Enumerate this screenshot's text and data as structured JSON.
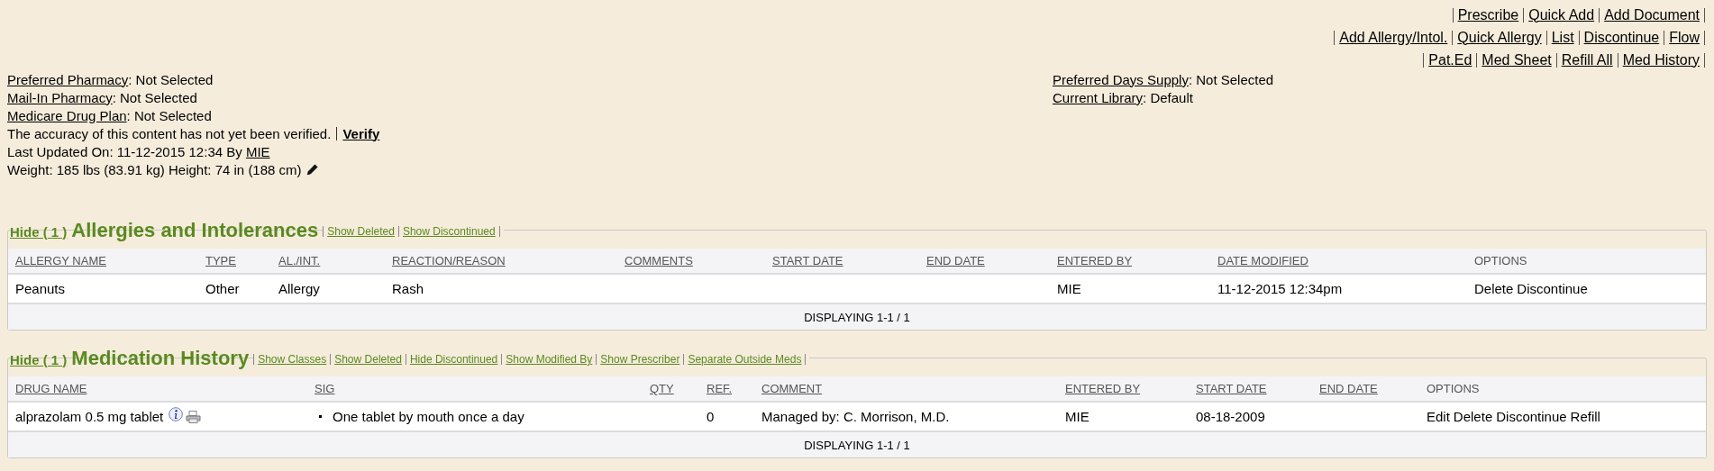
{
  "toolbar": {
    "rows": [
      [
        "Prescribe",
        "Quick Add",
        "Add Document"
      ],
      [
        "Add Allergy/Intol.",
        "Quick Allergy",
        "List",
        "Discontinue",
        "Flow"
      ],
      [
        "Pat.Ed",
        "Med Sheet",
        "Refill All",
        "Med History"
      ]
    ]
  },
  "info": {
    "left": [
      {
        "kind": "field",
        "label": "Preferred Pharmacy",
        "value": ": Not Selected"
      },
      {
        "kind": "field",
        "label": "Mail-In Pharmacy",
        "value": ": Not Selected"
      },
      {
        "kind": "field",
        "label": "Medicare Drug Plan",
        "value": ": Not Selected"
      },
      {
        "kind": "verify",
        "text": "The accuracy of this content has not yet been verified.",
        "link": "Verify"
      },
      {
        "kind": "updated",
        "text": "Last Updated On: 11-12-2015 12:34 By",
        "link": "MIE"
      },
      {
        "kind": "vitals",
        "text": "Weight: 185 lbs (83.91 kg) Height: 74 in (188 cm)"
      }
    ],
    "right": [
      {
        "kind": "field",
        "label": "Preferred Days Supply",
        "value": ": Not Selected"
      },
      {
        "kind": "field",
        "label": "Current Library",
        "value": ": Default"
      }
    ]
  },
  "sections": [
    {
      "toggle": "Hide ( 1 )",
      "title": "Allergies and Intolerances",
      "links": [
        "Show Deleted",
        "Show Discontinued"
      ],
      "columns": [
        {
          "label": "ALLERGY NAME",
          "sortable": true,
          "kind": "text"
        },
        {
          "label": "TYPE",
          "sortable": true,
          "kind": "text"
        },
        {
          "label": "AL./INT.",
          "sortable": true,
          "kind": "text"
        },
        {
          "label": "REACTION/REASON",
          "sortable": true,
          "kind": "text"
        },
        {
          "label": "COMMENTS",
          "sortable": true,
          "kind": "text"
        },
        {
          "label": "START DATE",
          "sortable": true,
          "kind": "text"
        },
        {
          "label": "END DATE",
          "sortable": true,
          "kind": "text"
        },
        {
          "label": "ENTERED BY",
          "sortable": true,
          "kind": "text"
        },
        {
          "label": "DATE MODIFIED",
          "sortable": true,
          "kind": "text"
        },
        {
          "label": "OPTIONS",
          "sortable": false,
          "kind": "options"
        }
      ],
      "rows": [
        {
          "cells": [
            "Peanuts",
            "Other",
            "Allergy",
            "Rash",
            null,
            null,
            null,
            "MIE",
            "11-12-2015 12:34pm",
            [
              "Delete",
              "Discontinue"
            ]
          ]
        }
      ],
      "footer": "DISPLAYING 1-1 / 1"
    },
    {
      "toggle": "Hide ( 1 )",
      "title": "Medication History",
      "links": [
        "Show Classes",
        "Show Deleted",
        "Hide Discontinued",
        "Show Modified By",
        "Show Prescriber",
        "Separate Outside Meds"
      ],
      "columns": [
        {
          "label": "DRUG NAME",
          "sortable": true,
          "kind": "drug"
        },
        {
          "label": "SIG",
          "sortable": true,
          "kind": "sig"
        },
        {
          "label": "QTY",
          "sortable": true,
          "kind": "text"
        },
        {
          "label": "REF.",
          "sortable": true,
          "kind": "text"
        },
        {
          "label": "COMMENT",
          "sortable": true,
          "kind": "text"
        },
        {
          "label": "ENTERED BY",
          "sortable": true,
          "kind": "text"
        },
        {
          "label": "START DATE",
          "sortable": true,
          "kind": "text"
        },
        {
          "label": "END DATE",
          "sortable": true,
          "kind": "text"
        },
        {
          "label": "OPTIONS",
          "sortable": false,
          "kind": "options"
        }
      ],
      "rows": [
        {
          "cells": [
            "alprazolam 0.5 mg tablet",
            "One tablet by mouth once a day",
            null,
            "0",
            "Managed by: C. Morrison, M.D.",
            "MIE",
            "08-18-2009",
            null,
            [
              "Edit",
              "Delete",
              "Discontinue",
              "Refill"
            ]
          ]
        }
      ],
      "footer": "DISPLAYING 1-1 / 1"
    }
  ]
}
